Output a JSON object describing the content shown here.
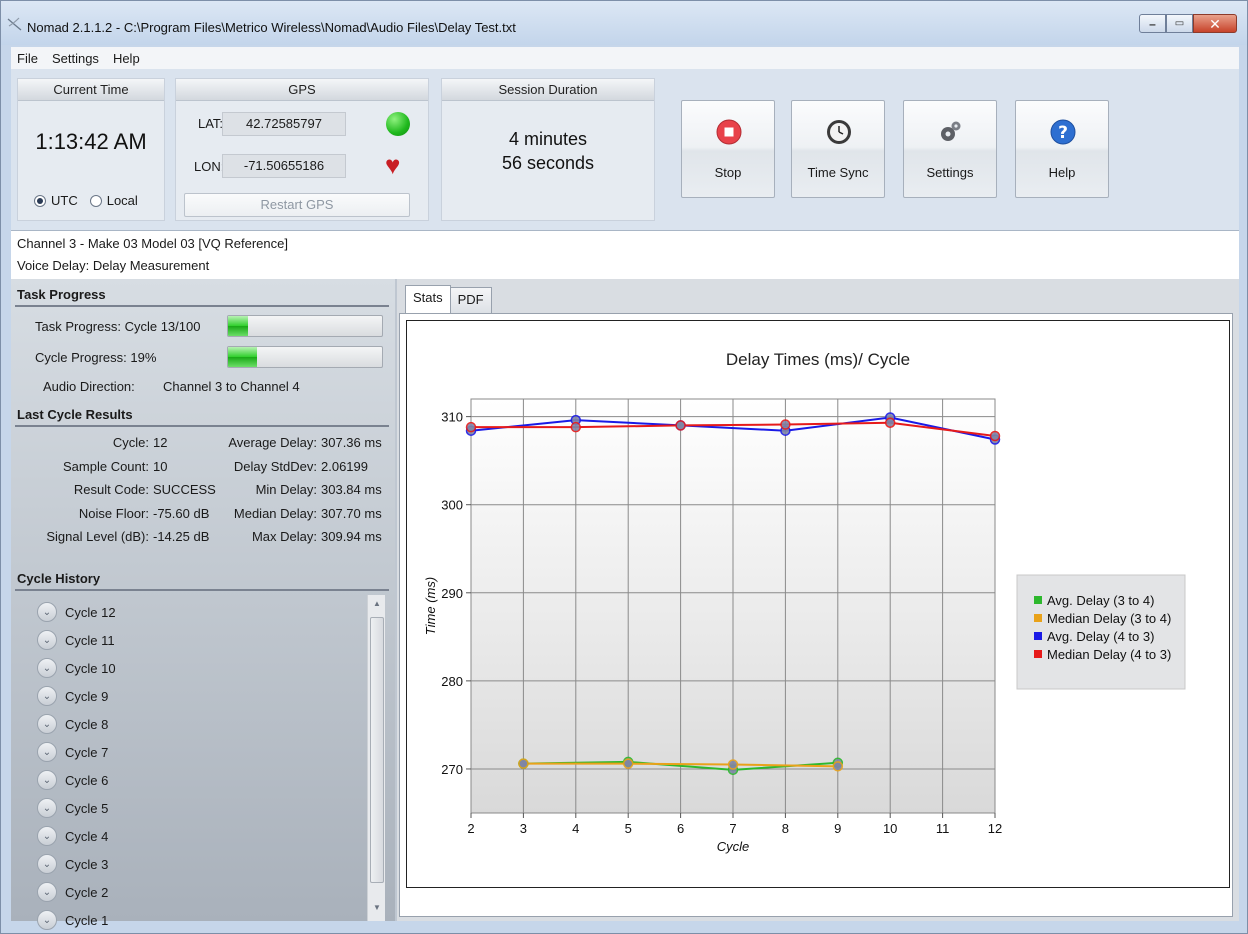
{
  "window": {
    "title": "Nomad 2.1.1.2 - C:\\Program Files\\Metrico Wireless\\Nomad\\Audio Files\\Delay Test.txt",
    "controls": [
      "minimize-icon",
      "maximize-icon",
      "close-icon"
    ]
  },
  "menu": {
    "items": [
      "File",
      "Settings",
      "Help"
    ]
  },
  "current_time": {
    "header": "Current Time",
    "value": "1:13:42 AM",
    "utc_label": "UTC",
    "local_label": "Local",
    "selected": "UTC"
  },
  "gps": {
    "header": "GPS",
    "lat_label": "LAT:",
    "lat_value": "42.72585797",
    "lon_label": "LON:",
    "lon_value": "-71.50655186",
    "restart_label": "Restart GPS",
    "status_color": "#1fb81d",
    "heart_color": "#c81e24"
  },
  "session": {
    "header": "Session Duration",
    "minutes": "4 minutes",
    "seconds": "56 seconds"
  },
  "buttons": {
    "stop": "Stop",
    "time_sync": "Time Sync",
    "settings": "Settings",
    "help": "Help"
  },
  "channel": {
    "line1": "Channel 3 - Make 03 Model 03 [VQ Reference]",
    "line2": "Voice Delay: Delay Measurement"
  },
  "task_progress": {
    "title": "Task Progress",
    "task_label": "Task Progress: Cycle 13/100",
    "task_fraction": 0.13,
    "cycle_label": "Cycle Progress: 19%",
    "cycle_fraction": 0.19,
    "direction_label": "Audio Direction:",
    "direction_value": "Channel 3 to Channel 4"
  },
  "last_cycle": {
    "title": "Last Cycle Results",
    "left": [
      {
        "label": "Cycle:",
        "value": "12"
      },
      {
        "label": "Sample Count:",
        "value": "10"
      },
      {
        "label": "Result Code:",
        "value": "SUCCESS"
      },
      {
        "label": "Noise Floor:",
        "value": "-75.60 dB"
      },
      {
        "label": "Signal Level (dB):",
        "value": "-14.25 dB"
      }
    ],
    "right": [
      {
        "label": "Average Delay:",
        "value": "307.36 ms"
      },
      {
        "label": "Delay StdDev:",
        "value": "2.06199"
      },
      {
        "label": "Min Delay:",
        "value": "303.84 ms"
      },
      {
        "label": "Median Delay:",
        "value": "307.70 ms"
      },
      {
        "label": "Max Delay:",
        "value": "309.94 ms"
      }
    ]
  },
  "cycle_history": {
    "title": "Cycle History",
    "items": [
      "Cycle 12",
      "Cycle 11",
      "Cycle 10",
      "Cycle 9",
      "Cycle 8",
      "Cycle 7",
      "Cycle 6",
      "Cycle 5",
      "Cycle 4",
      "Cycle 3",
      "Cycle 2",
      "Cycle 1"
    ]
  },
  "tabs": [
    "Stats",
    "PDF"
  ],
  "chart_data": {
    "type": "line",
    "title": "Delay Times (ms)/ Cycle",
    "xlabel": "Cycle",
    "ylabel": "Time (ms)",
    "xlim": [
      2,
      12
    ],
    "ylim": [
      265,
      312
    ],
    "xticks": [
      2,
      3,
      4,
      5,
      6,
      7,
      8,
      9,
      10,
      11,
      12
    ],
    "yticks": [
      270,
      280,
      290,
      300,
      310
    ],
    "grid": true,
    "legend_position": "right",
    "series": [
      {
        "name": "Avg. Delay (3 to 4)",
        "color": "#2db82d",
        "x": [
          3,
          5,
          7,
          9
        ],
        "y": [
          270.6,
          270.8,
          269.9,
          270.7
        ]
      },
      {
        "name": "Median Delay (3 to 4)",
        "color": "#e9a21a",
        "x": [
          3,
          5,
          7,
          9
        ],
        "y": [
          270.6,
          270.6,
          270.5,
          270.3
        ]
      },
      {
        "name": "Avg. Delay (4 to 3)",
        "color": "#1a1ae6",
        "x": [
          2,
          4,
          6,
          8,
          10,
          12
        ],
        "y": [
          308.4,
          309.6,
          309.0,
          308.4,
          309.9,
          307.4
        ]
      },
      {
        "name": "Median Delay (4 to 3)",
        "color": "#e61a1a",
        "x": [
          2,
          4,
          6,
          8,
          10,
          12
        ],
        "y": [
          308.8,
          308.8,
          309.0,
          309.1,
          309.3,
          307.8
        ]
      }
    ]
  }
}
